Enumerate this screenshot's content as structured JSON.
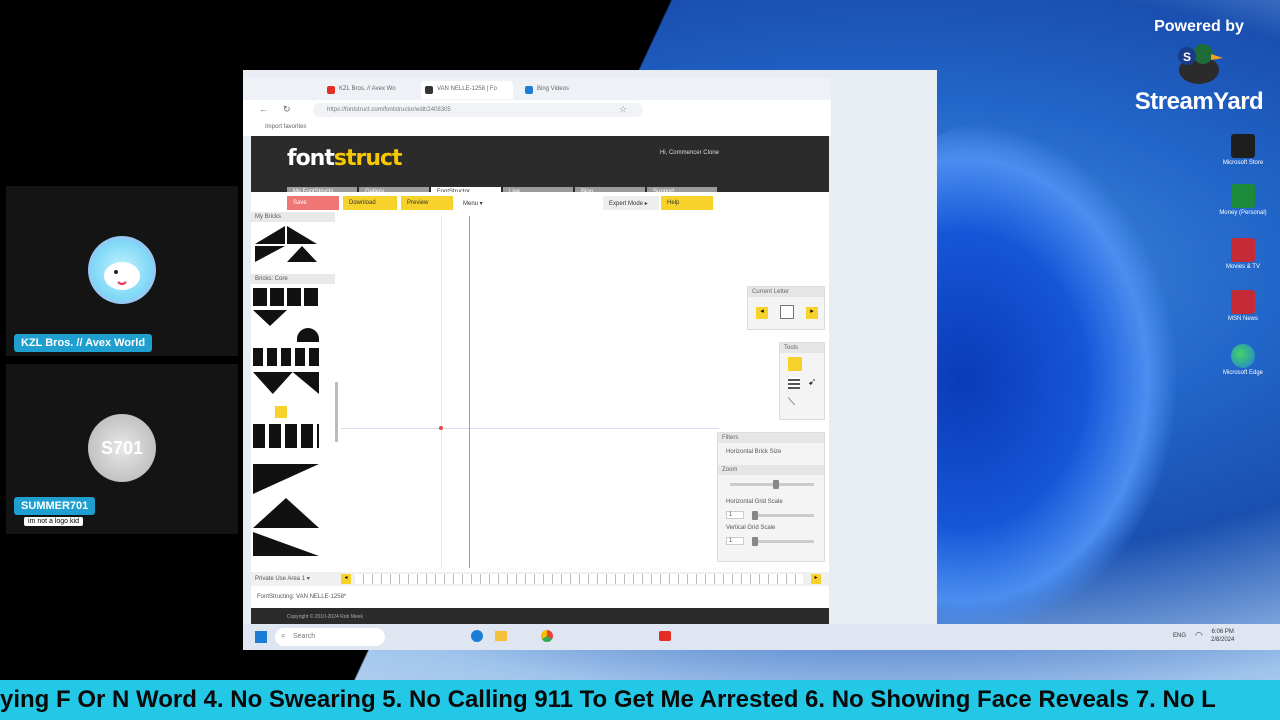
{
  "overlay": {
    "powered_by": "Powered by",
    "brand": "StreamYard",
    "ticker": "ying F Or N Word 4. No Swearing 5. No Calling 911 To Get Me Arrested 6. No Showing Face Reveals 7. No L"
  },
  "participants": [
    {
      "name": "KZL Bros. // Avex World",
      "subtitle": "",
      "avatar_text": ""
    },
    {
      "name": "SUMMER701",
      "subtitle": "im not a logo kid",
      "avatar_text": "S701"
    }
  ],
  "desktop_icons": [
    {
      "label": "Microsoft Store",
      "color": "#1e1e1e"
    },
    {
      "label": "Money (Personal)",
      "color": "#1d8a3a"
    },
    {
      "label": "Movies & TV",
      "color": "#c52a37"
    },
    {
      "label": "MSN News",
      "color": "#c52a37"
    },
    {
      "label": "Microsoft Edge",
      "color": "#1b7ed6"
    }
  ],
  "browser": {
    "tabs": [
      {
        "label": "KZL Bros. // Avex Wo",
        "fav_color": "#e52d27"
      },
      {
        "label": "VAN NELLE-1258 | Fo",
        "fav_color": "#333333"
      },
      {
        "label": "Bing Videos",
        "fav_color": "#1b7ed6"
      }
    ],
    "url": "https://fontstruct.com/fontstructor/edit/2408305",
    "favorites_label": "Import favorites"
  },
  "fontstruct": {
    "logo_a": "font",
    "logo_b": "struct",
    "user_text": "Hi, Commencer Clone",
    "nav": [
      "My FontStructs",
      "Gallery",
      "FontStructor",
      "Live",
      "Blog",
      "Support"
    ],
    "active_nav": "FontStructor",
    "buttons": {
      "save": "Save",
      "download": "Download",
      "preview": "Preview",
      "menu": "Menu",
      "expert": "Expert Mode",
      "help": "Help"
    },
    "my_bricks": "My Bricks",
    "bricks_core": "Bricks: Core",
    "current_letter": "Current Letter",
    "tools": "Tools",
    "fitness": "Filters",
    "h_brick_size": "Horizontal Brick Size",
    "zoom": "Zoom",
    "h_grid_scale": "Horizontal Grid Scale",
    "v_grid_scale": "Vertical Grid Scale",
    "grid_h_value": "1",
    "grid_v_value": "1",
    "zoom_level": 0.55,
    "charset_select": "Private Use Area 1",
    "status": "FontStructing: VAN NELLE-1258*",
    "footer": "Copyright © 2010-2024 Rob Meek"
  },
  "taskbar": {
    "search": "Search",
    "time": "6:06 PM",
    "date": "2/8/2024",
    "lang": "ENG"
  }
}
